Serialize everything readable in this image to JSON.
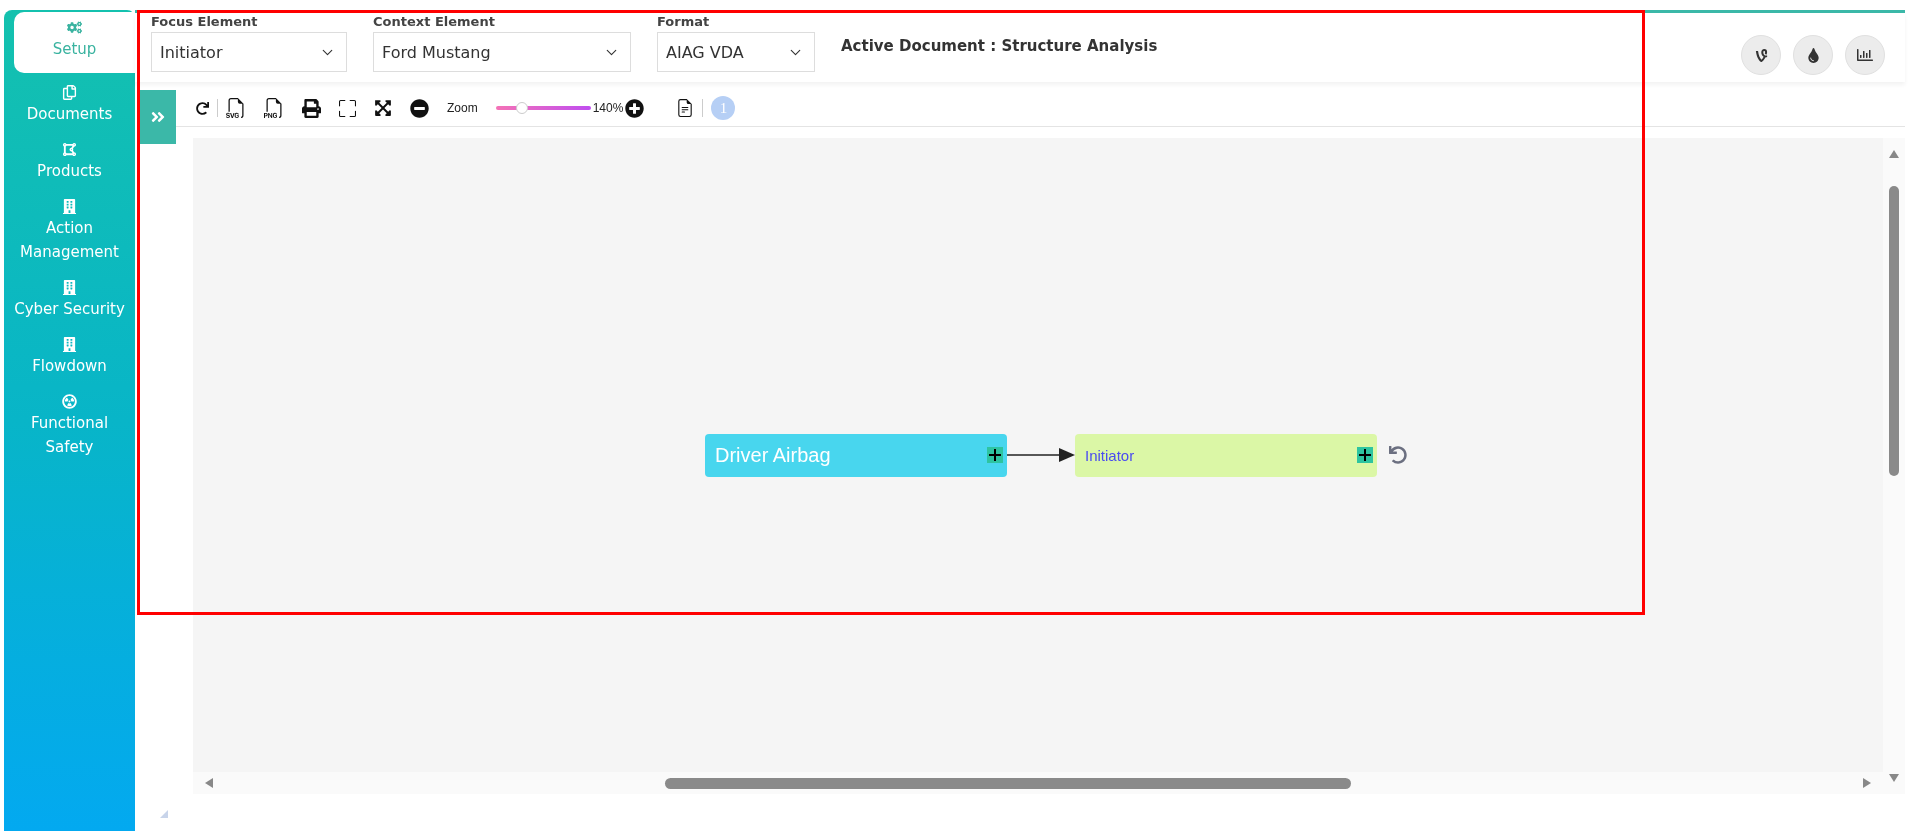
{
  "sidebar": {
    "items": [
      {
        "label": "Setup",
        "selected": true
      },
      {
        "label": "Documents",
        "selected": false
      },
      {
        "label": "Products",
        "selected": false
      },
      {
        "label": "Action Management",
        "selected": false
      },
      {
        "label": "Cyber Security",
        "selected": false
      },
      {
        "label": "Flowdown",
        "selected": false
      },
      {
        "label": "Functional Safety",
        "selected": false
      }
    ]
  },
  "header": {
    "fields": [
      {
        "label": "Focus Element",
        "value": "Initiator"
      },
      {
        "label": "Context Element",
        "value": "Ford Mustang"
      },
      {
        "label": "Format",
        "value": "AIAG VDA"
      }
    ],
    "active_document": "Active Document : Structure Analysis"
  },
  "toolbar": {
    "zoom_label": "Zoom",
    "zoom": {
      "level": 0.28
    },
    "zoom_reading": "140%",
    "page_badge": "1"
  },
  "diagram": {
    "nodes": [
      {
        "label": "Driver Airbag",
        "kind": "parent"
      },
      {
        "label": "Initiator",
        "kind": "focus"
      }
    ]
  }
}
